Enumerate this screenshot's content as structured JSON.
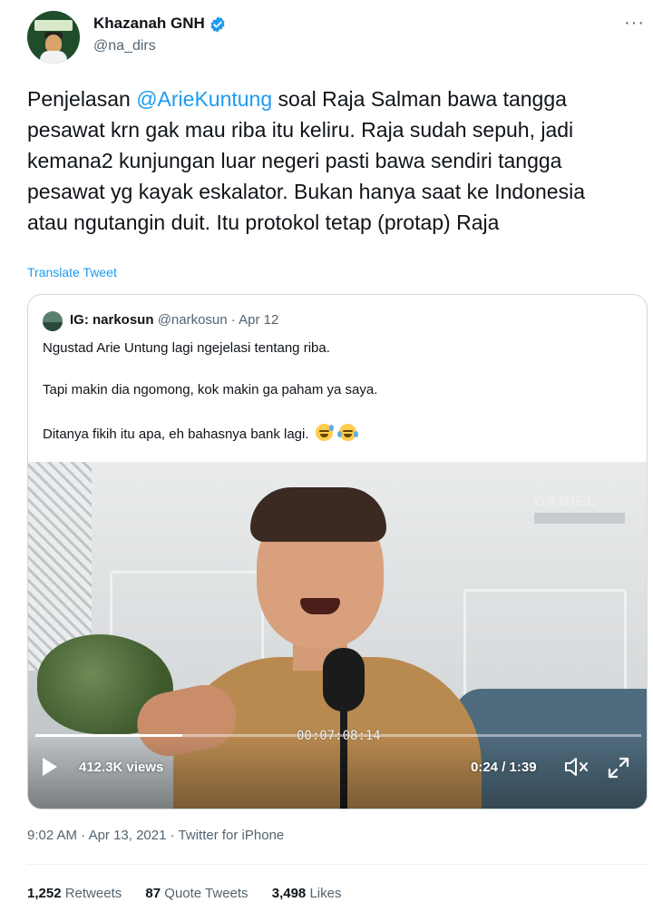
{
  "author": {
    "display_name": "Khazanah GNH",
    "handle": "@na_dirs",
    "verified": true
  },
  "tweet": {
    "text_before": "Penjelasan ",
    "mention": "@ArieKuntung",
    "text_after": " soal Raja Salman bawa tangga pesawat krn gak mau riba itu keliru. Raja sudah sepuh, jadi kemana2 kunjungan luar negeri pasti bawa sendiri tangga pesawat yg kayak eskalator. Bukan hanya saat ke Indonesia atau ngutangin duit. Itu protokol tetap (protap) Raja",
    "translate_label": "Translate Tweet"
  },
  "quote": {
    "name": "IG: narkosun",
    "handle": "@narkosun",
    "separator": "·",
    "date": "Apr 12",
    "line1": "Ngustad Arie Untung lagi ngejelasi tentang riba.",
    "line2": "Tapi makin dia ngomong, kok makin ga paham ya saya.",
    "line3": "Ditanya fikih itu apa, eh bahasnya bank lagi.",
    "emojis": [
      "sweat-smile-emoji",
      "crying-laughing-emoji"
    ]
  },
  "video": {
    "watermark": "DANIEL",
    "timecode": "00:07:08:14",
    "views": "412.3K views",
    "time": "0:24 / 1:39",
    "progress": 0.242
  },
  "meta": {
    "time": "9:02 AM",
    "separator": "·",
    "date": "Apr 13, 2021",
    "source": "Twitter for iPhone"
  },
  "stats": {
    "retweets_count": "1,252",
    "retweets_label": "Retweets",
    "quotes_count": "87",
    "quotes_label": "Quote Tweets",
    "likes_count": "3,498",
    "likes_label": "Likes"
  },
  "colors": {
    "link": "#1d9bf0",
    "text": "#0f1419",
    "secondary": "#536471",
    "border": "#cfd9de"
  }
}
